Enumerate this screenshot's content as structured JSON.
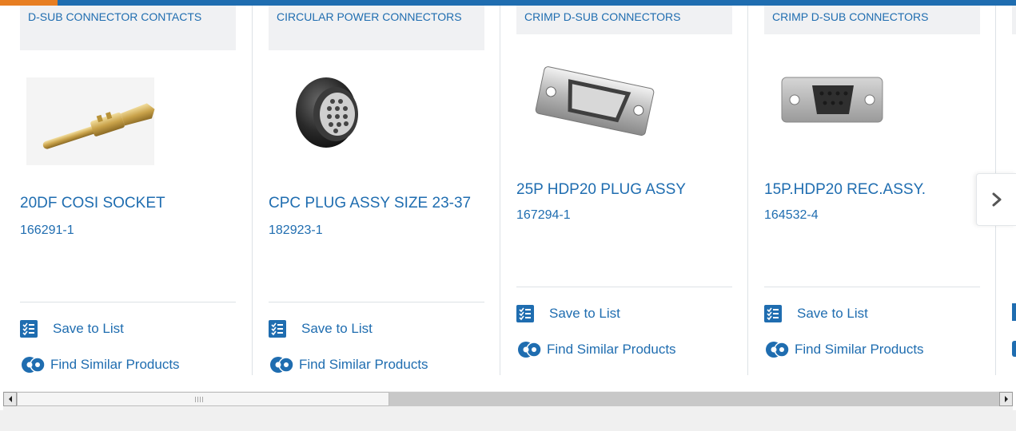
{
  "cards": [
    {
      "category": "D-SUB CONNECTOR CONTACTS",
      "title": "20DF COSI SOCKET",
      "part_number": "166291-1",
      "image_icon": "d-sub-contact-image"
    },
    {
      "category": "CIRCULAR POWER CONNECTORS",
      "title": "CPC PLUG ASSY SIZE 23-37",
      "part_number": "182923-1",
      "image_icon": "circular-connector-image"
    },
    {
      "category": "CRIMP D-SUB CONNECTORS",
      "title": "25P HDP20 PLUG ASSY",
      "part_number": "167294-1",
      "image_icon": "d-sub-plug-image"
    },
    {
      "category": "CRIMP D-SUB CONNECTORS",
      "title": "15P.HDP20 REC.ASSY.",
      "part_number": "164532-4",
      "image_icon": "d-sub-receptacle-image"
    }
  ],
  "actions": {
    "save_label": "Save to List",
    "find_label": "Find Similar Products"
  },
  "icons": {
    "save": "save-list-icon",
    "find": "find-similar-icon",
    "next": "chevron-right-icon",
    "scroll_left": "scroll-left-arrow-icon",
    "scroll_right": "scroll-right-arrow-icon"
  },
  "colors": {
    "link": "#1f6db0",
    "accent": "#e77e22",
    "tag_background": "#f0f1f3"
  }
}
